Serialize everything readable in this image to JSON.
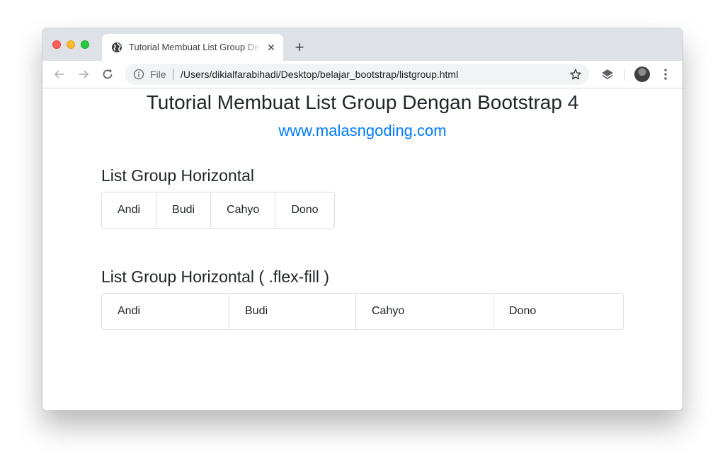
{
  "browser": {
    "tab_title": "Tutorial Membuat List Group Dengan Bootstrap 4",
    "scheme_label": "File",
    "url": "/Users/dikialfarabihadi/Desktop/belajar_bootstrap/listgroup.html",
    "new_tab_label": "+",
    "close_label": "✕"
  },
  "page": {
    "title": "Tutorial Membuat List Group Dengan Bootstrap 4",
    "site": "www.malasngoding.com",
    "section1": {
      "title": "List Group Horizontal",
      "items": [
        "Andi",
        "Budi",
        "Cahyo",
        "Dono"
      ]
    },
    "section2": {
      "title": "List Group Horizontal ( .flex-fill )",
      "items": [
        "Andi",
        "Budi",
        "Cahyo",
        "Dono"
      ]
    }
  },
  "colors": {
    "link": "#007bff",
    "text": "#212529",
    "tabstrip": "#dee1e6"
  }
}
